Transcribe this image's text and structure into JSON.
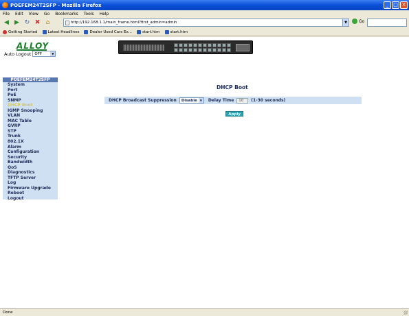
{
  "window": {
    "title": "POEFEM24T2SFP - Mozilla Firefox",
    "minimize": "_",
    "maximize": "□",
    "close": "✕"
  },
  "menu": [
    "File",
    "Edit",
    "View",
    "Go",
    "Bookmarks",
    "Tools",
    "Help"
  ],
  "address": {
    "url": "http://192.168.1.1/main_frame.html?first_admin=admin",
    "go_label": "Go"
  },
  "bookmarks": [
    "Getting Started",
    "Latest Headlines",
    "Dealer Used Cars Ex...",
    "start.htm",
    "start.htm"
  ],
  "header": {
    "logo_text": "ALLOY",
    "auto_logout_label": "Auto Logout",
    "auto_logout_value": "OFF"
  },
  "sidebar": {
    "title": "POEFEM24T2SFP",
    "items": [
      "System",
      "Port",
      "PoE",
      "SNMP",
      "DHCP Boot",
      "IGMP Snooping",
      "VLAN",
      "MAC Table",
      "GVRP",
      "STP",
      "Trunk",
      "802.1X",
      "Alarm",
      "Configuration",
      "Security",
      "Bandwidth",
      "QoS",
      "Diagnostics",
      "TFTP Server",
      "Log",
      "Firmware Upgrade",
      "Reboot",
      "Logout"
    ],
    "active_index": 4
  },
  "main": {
    "title": "DHCP Boot",
    "broadcast_label": "DHCP Broadcast Suppression",
    "broadcast_value": "Disable",
    "delay_label": "Delay Time",
    "delay_value": "10",
    "delay_hint": "(1-30 seconds)",
    "apply_label": "Apply"
  },
  "status": {
    "text": "Done"
  },
  "colors": {
    "accent": "#2aa0b0",
    "sidebar_bg": "#cfe0f2",
    "active_item": "#d6c95a"
  }
}
